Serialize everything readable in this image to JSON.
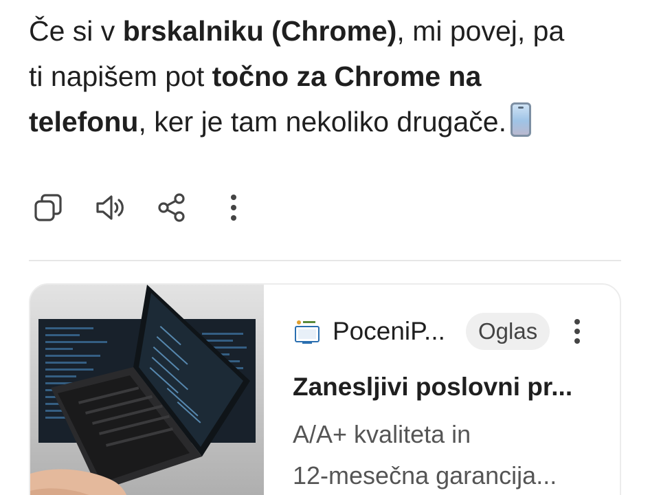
{
  "message": {
    "line1_pre": "Če si v ",
    "line1_bold": "brskalniku (Chrome)",
    "line1_post": ", mi povej, pa",
    "line2_pre": "ti napišem pot ",
    "line2_bold": "točno za Chrome na",
    "line3_bold": "telefonu",
    "line3_post": ", ker je tam nekoliko drugače.",
    "emoji_icon": "mobile-phone-icon"
  },
  "actions": {
    "copy_icon": "copy-icon",
    "read_aloud_icon": "speaker-icon",
    "share_icon": "share-icon",
    "more_icon": "more-vertical-icon"
  },
  "ad": {
    "image_icon": "laptop-photo",
    "brand_name": "PoceniP...",
    "badge": "Oglas",
    "title": "Zanesljivi poslovni pr...",
    "desc_line1": "A/A+ kvaliteta in",
    "desc_line2": "12-mesečna garancija..."
  },
  "colors": {
    "text": "#1f1f1f",
    "muted": "#555555",
    "icon": "#444444",
    "divider": "#e6e6e6",
    "badge_bg": "#efefef"
  }
}
